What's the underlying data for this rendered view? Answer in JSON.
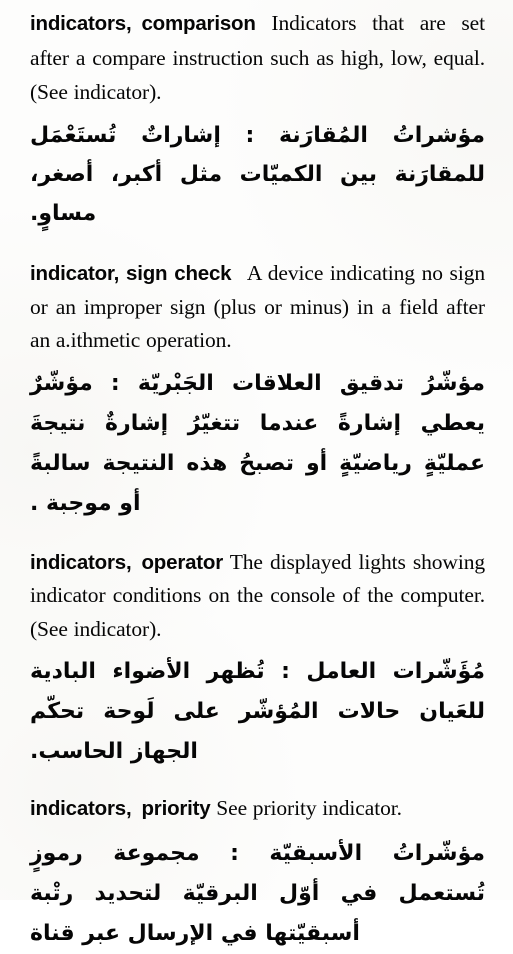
{
  "page": {
    "background_color": "#fdfdfc",
    "text_color": "#060606",
    "language_pair": "English-Arabic"
  },
  "entries": [
    {
      "headword": "indicators,",
      "headword_qualifier": "comparison",
      "definition_en": "Indicators that are set after a compare instruction such as high, low, equal. (See indicator).",
      "term_ar": "مؤشراتُ المُقارَنة :",
      "definition_ar": "إشاراتٌ تُستَعْمَل للمقارَنة بين الكميّات مثل أكبر، أصغر، مساوٍ."
    },
    {
      "headword": "indicator, sign check",
      "headword_qualifier": "",
      "definition_en": "A device indicating no sign or an improper sign (plus or minus) in a field after an a.ithmetic operation.",
      "term_ar": "مؤشّرُ تدقيق العلاقات الجَبْريّة :",
      "definition_ar": "مؤشّرٌ يعطي إشارةً عندما تتغيّرُ إشارةٌ نتيجةَ عمليّةٍ رياضيّةٍ أو تصبحُ هذه النتيجة سالبةً أو موجبة ."
    },
    {
      "headword": "indicators,",
      "headword_qualifier": "operator",
      "definition_en": "The displayed lights showing indicator conditions on the console of the computer. (See indicator).",
      "term_ar": "مُؤَشّرات العامل :",
      "definition_ar": "تُظهر الأضواء البادية للعَيان حالات المُؤشّر على لَوحة تحكّم الجهاز الحاسب."
    },
    {
      "headword": "indicators,",
      "headword_qualifier": "priority",
      "definition_en": "See priority indicator.",
      "term_ar": "مؤشّراتُ الأسبقيّة :",
      "definition_ar": "مجموعة رموزٍ تُستعمل في أوّل البرقيّة لتحديد رتْبة أسبقيّتها في الإرسال عبر قناة"
    }
  ]
}
